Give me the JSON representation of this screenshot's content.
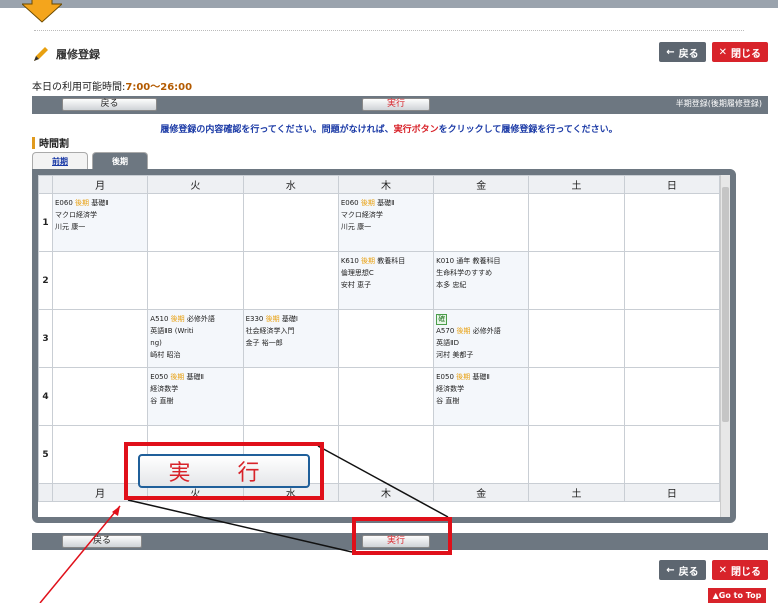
{
  "page": {
    "title": "履修登録",
    "availability_label": "本日の利用可能時間:",
    "availability_time": "7:00〜26:00",
    "phase_note": "半期登録(後期履修登録)"
  },
  "header": {
    "back_label": "戻る",
    "close_label": "閉じる"
  },
  "actionbar": {
    "back_label": "戻る",
    "execute_label": "実行"
  },
  "instruction": {
    "part1": "履修登録の内容確認を行ってください。問題がなければ、",
    "part2": "実行ボタン",
    "part3": "をクリックして履修登録を行ってください。"
  },
  "section_title": "時間割",
  "tabs": [
    {
      "label": "前期"
    },
    {
      "label": "後期"
    }
  ],
  "days": [
    "月",
    "火",
    "水",
    "木",
    "金",
    "土",
    "日"
  ],
  "periods": [
    "1",
    "2",
    "3",
    "4",
    "5"
  ],
  "cells": {
    "p1_mon": {
      "code": "E060",
      "term": "後期",
      "cat": "基礎Ⅱ",
      "name": "マクロ経済学",
      "teacher": "川元 康一"
    },
    "p1_thu": {
      "code": "E060",
      "term": "後期",
      "cat": "基礎Ⅱ",
      "name": "マクロ経済学",
      "teacher": "川元 康一"
    },
    "p2_thu": {
      "code": "K610",
      "term": "後期",
      "cat": "教養科目",
      "name": "倫理思想C",
      "teacher": "安村 恵子"
    },
    "p2_fri": {
      "code": "K010",
      "term": "通年",
      "cat": "教養科目",
      "name": "生命科学のすすめ",
      "teacher": "本多 忠紀"
    },
    "p3_tue": {
      "code": "A510",
      "term": "後期",
      "cat": "必修外語",
      "name": "英語ⅡB (Writi",
      "name2": "ng)",
      "teacher": "崎村 昭治"
    },
    "p3_wed": {
      "code": "E330",
      "term": "後期",
      "cat": "基礎Ⅰ",
      "name": "社会経済学入門",
      "teacher": "金子 裕一郎"
    },
    "p3_fri": {
      "badge": "確",
      "code": "A570",
      "term": "後期",
      "cat": "必修外語",
      "name": "英語ⅡD",
      "teacher": "河村 美都子"
    },
    "p4_tue": {
      "code": "E050",
      "term": "後期",
      "cat": "基礎Ⅱ",
      "name": "経済数学",
      "teacher": "谷 直樹"
    },
    "p4_fri": {
      "code": "E050",
      "term": "後期",
      "cat": "基礎Ⅱ",
      "name": "経済数学",
      "teacher": "谷 直樹"
    }
  },
  "callout_label": "実 行",
  "gotop_label": "▲Go to Top"
}
